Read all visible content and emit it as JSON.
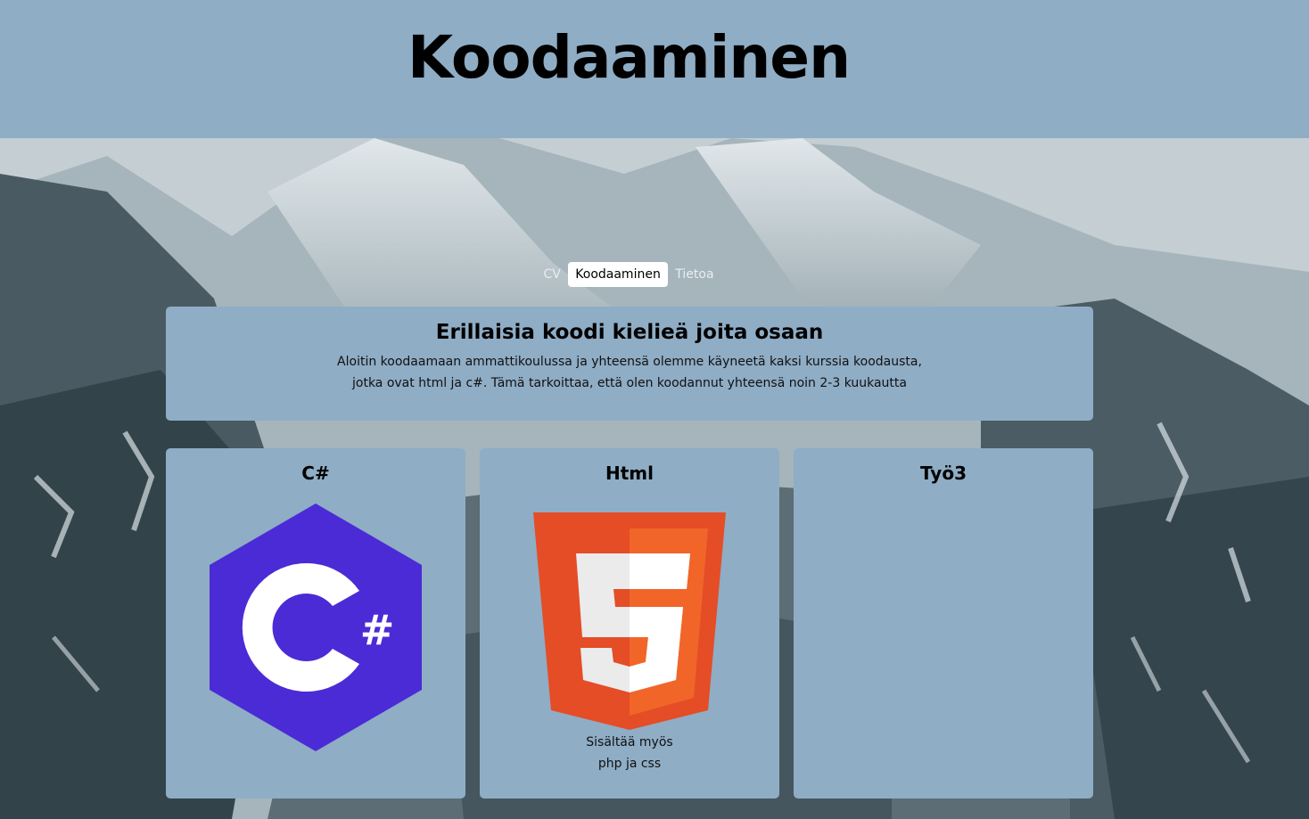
{
  "header": {
    "title": "Koodaaminen"
  },
  "nav": {
    "items": [
      {
        "label": "CV"
      },
      {
        "label": "Koodaaminen"
      },
      {
        "label": "Tietoa"
      }
    ]
  },
  "intro": {
    "heading": "Erillaisia koodi kielieä joita osaan",
    "line1": "Aloitin koodaamaan ammattikoulussa ja yhteensä olemme käyneetä kaksi kurssia koodausta,",
    "line2": "jotka ovat html ja c#. Tämä tarkoittaa, että olen koodannut yhteensä noin 2-3 kuukautta"
  },
  "cards": [
    {
      "title": "C#",
      "logo_text": "#"
    },
    {
      "title": "Html",
      "logo_text": "5",
      "note_line1": "Sisältää myös",
      "note_line2": "php ja css"
    },
    {
      "title": "Työ3"
    }
  ],
  "colors": {
    "panel": "#8fadc5",
    "csharp_purple": "#4b2bd6",
    "html_orange": "#e44d26",
    "html_orange_light": "#f16529"
  }
}
